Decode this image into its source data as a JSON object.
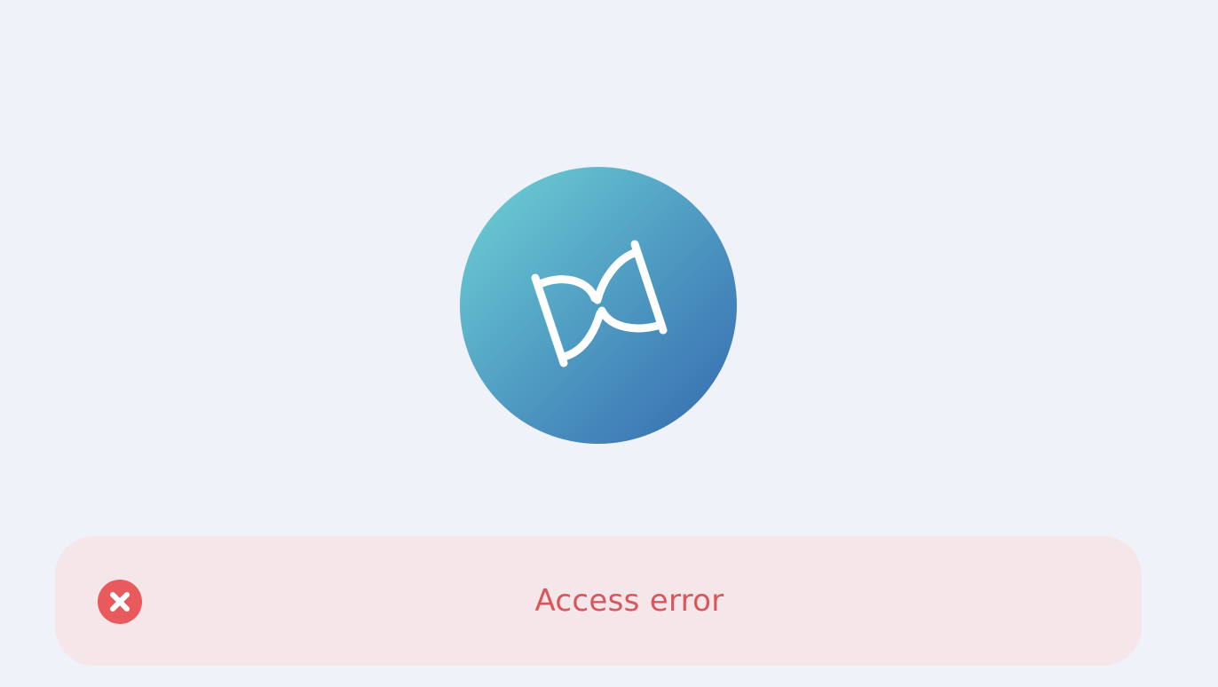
{
  "logo": {
    "icon": "hourglass-bow-logo-icon",
    "gradient_colors": [
      "#356aaf",
      "#70d2d4"
    ]
  },
  "error_banner": {
    "icon": "error-x-icon",
    "message": "Access error",
    "text_color": "#d9565a",
    "background_color": "#f5e6e9",
    "icon_color": "#e85a5c"
  }
}
